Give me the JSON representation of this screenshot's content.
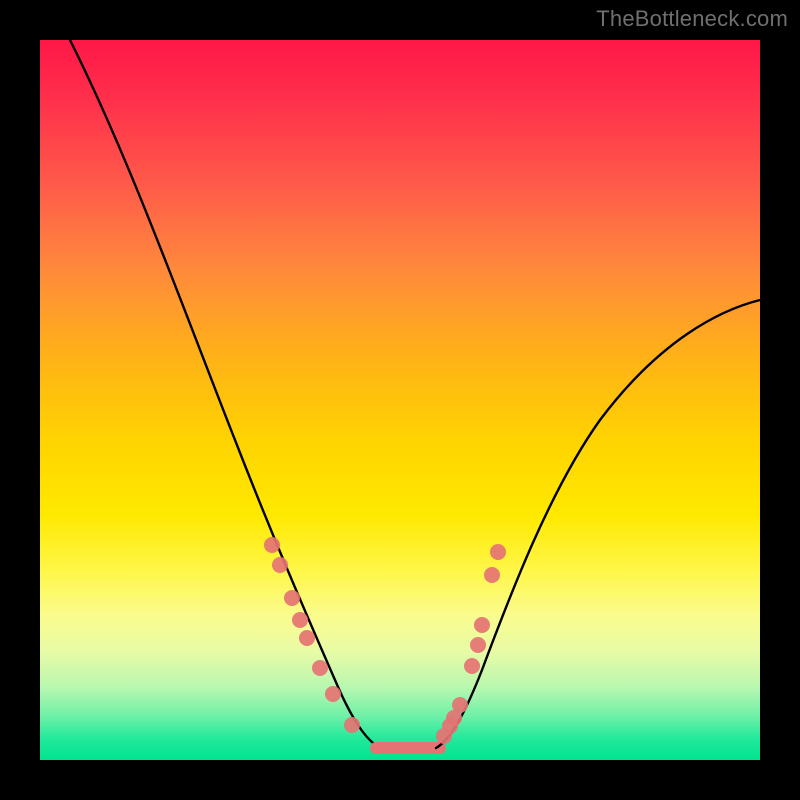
{
  "watermark": "TheBottleneck.com",
  "colors": {
    "dot": "#e57373",
    "curve": "#000000",
    "background_black": "#000000"
  },
  "chart_data": {
    "type": "line",
    "title": "",
    "xlabel": "",
    "ylabel": "",
    "xlim": [
      0,
      100
    ],
    "ylim": [
      0,
      100
    ],
    "series": [
      {
        "name": "left-curve",
        "x": [
          0,
          6,
          12,
          18,
          24,
          28,
          32,
          34,
          36,
          38,
          40,
          42,
          44,
          46
        ],
        "values": [
          100,
          86,
          72,
          58,
          44,
          34,
          24,
          19,
          14,
          10,
          7,
          4.5,
          2.5,
          1.5
        ]
      },
      {
        "name": "right-curve",
        "x": [
          54,
          56,
          58,
          60,
          64,
          70,
          76,
          84,
          92,
          100
        ],
        "values": [
          1.5,
          3,
          5.5,
          9,
          18,
          30,
          40,
          50,
          58,
          64
        ]
      },
      {
        "name": "flat-minimum",
        "x": [
          46,
          54
        ],
        "values": [
          1.5,
          1.5
        ]
      }
    ],
    "markers": {
      "left_cluster": [
        {
          "x": 30,
          "y": 28
        },
        {
          "x": 31.5,
          "y": 25
        },
        {
          "x": 33,
          "y": 20
        },
        {
          "x": 34,
          "y": 17
        },
        {
          "x": 35,
          "y": 15
        },
        {
          "x": 37,
          "y": 11
        },
        {
          "x": 39,
          "y": 8
        },
        {
          "x": 42,
          "y": 4.5
        }
      ],
      "right_cluster": [
        {
          "x": 55,
          "y": 2.5
        },
        {
          "x": 56,
          "y": 4
        },
        {
          "x": 56.5,
          "y": 5
        },
        {
          "x": 57.5,
          "y": 6.5
        },
        {
          "x": 59,
          "y": 12
        },
        {
          "x": 60,
          "y": 15
        },
        {
          "x": 60.5,
          "y": 18
        },
        {
          "x": 62,
          "y": 25
        },
        {
          "x": 63,
          "y": 28
        }
      ]
    }
  }
}
